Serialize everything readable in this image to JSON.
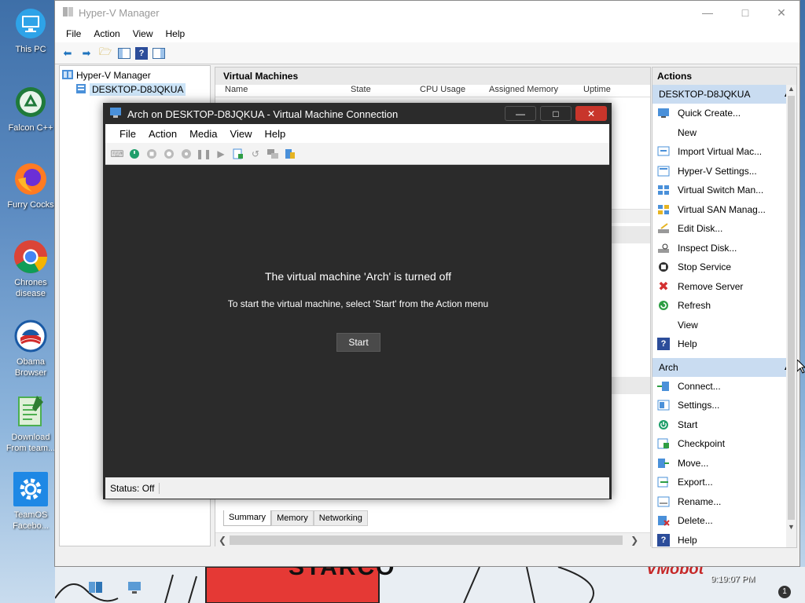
{
  "desktop": {
    "icons": [
      {
        "label": "This PC",
        "icon": "monitor-icon"
      },
      {
        "label": "Falcon C++",
        "icon": "recycle-icon"
      },
      {
        "label": "Furry Cocks",
        "icon": "firefox-icon"
      },
      {
        "label": "Chrones disease",
        "icon": "chrome-icon"
      },
      {
        "label": "Obama Browser",
        "icon": "obama-logo-icon"
      },
      {
        "label": "Download From team...",
        "icon": "notepad-icon"
      },
      {
        "label": "TeamOS Facebo...",
        "icon": "gear-icon"
      }
    ],
    "bottom_text_1": "STARCO",
    "bottom_text_2": "VMobot",
    "clock": "9:19:07 PM",
    "notification_count": "1"
  },
  "hyperv": {
    "title": "Hyper-V Manager",
    "menu": [
      "File",
      "Action",
      "View",
      "Help"
    ],
    "tree": {
      "root": "Hyper-V Manager",
      "child": "DESKTOP-D8JQKUA"
    },
    "center": {
      "vm_header": "Virtual Machines",
      "columns": [
        "Name",
        "State",
        "CPU Usage",
        "Assigned Memory",
        "Uptime"
      ],
      "tabs": [
        "Summary",
        "Memory",
        "Networking"
      ]
    },
    "actions": {
      "header": "Actions",
      "sections": [
        {
          "title": "DESKTOP-D8JQKUA",
          "items": [
            {
              "label": "Quick Create...",
              "icon": "quick-create-icon"
            },
            {
              "label": "New",
              "icon": "",
              "submenu": true
            },
            {
              "label": "Import Virtual Mac...",
              "icon": "import-icon"
            },
            {
              "label": "Hyper-V Settings...",
              "icon": "settings-icon"
            },
            {
              "label": "Virtual Switch Man...",
              "icon": "switch-icon"
            },
            {
              "label": "Virtual SAN Manag...",
              "icon": "san-icon"
            },
            {
              "label": "Edit Disk...",
              "icon": "edit-disk-icon"
            },
            {
              "label": "Inspect Disk...",
              "icon": "inspect-disk-icon"
            },
            {
              "label": "Stop Service",
              "icon": "stop-icon"
            },
            {
              "label": "Remove Server",
              "icon": "remove-icon"
            },
            {
              "label": "Refresh",
              "icon": "refresh-icon"
            },
            {
              "label": "View",
              "icon": "",
              "submenu": true
            },
            {
              "label": "Help",
              "icon": "help-icon"
            }
          ]
        },
        {
          "title": "Arch",
          "items": [
            {
              "label": "Connect...",
              "icon": "connect-icon"
            },
            {
              "label": "Settings...",
              "icon": "vm-settings-icon"
            },
            {
              "label": "Start",
              "icon": "power-icon"
            },
            {
              "label": "Checkpoint",
              "icon": "checkpoint-icon"
            },
            {
              "label": "Move...",
              "icon": "move-icon"
            },
            {
              "label": "Export...",
              "icon": "export-icon"
            },
            {
              "label": "Rename...",
              "icon": "rename-icon"
            },
            {
              "label": "Delete...",
              "icon": "delete-icon"
            },
            {
              "label": "Help",
              "icon": "help-icon"
            }
          ]
        }
      ]
    }
  },
  "vmconnect": {
    "title": "Arch on DESKTOP-D8JQKUA - Virtual Machine Connection",
    "menu": [
      "File",
      "Action",
      "Media",
      "View",
      "Help"
    ],
    "message": "The virtual machine 'Arch' is turned off",
    "submessage": "To start the virtual machine, select 'Start' from the Action menu",
    "start_button": "Start",
    "status": "Status: Off"
  },
  "colors": {
    "accent": "#c9dcf1",
    "close_red": "#e81123",
    "vm_screen": "#2b2b2b"
  }
}
